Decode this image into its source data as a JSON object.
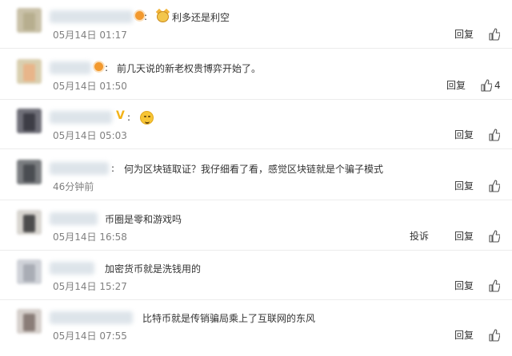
{
  "comments": [
    {
      "content": "利多还是利空",
      "time": "05月14日 01:17",
      "reply_label": "回复",
      "likes": "",
      "report_label": "",
      "avatar_color": "#c9c1a8",
      "avatar_core": "#b7ae8f"
    },
    {
      "content": "前几天说的新老权贵博弈开始了。",
      "time": "05月14日 01:50",
      "reply_label": "回复",
      "likes": "4",
      "report_label": "",
      "avatar_color": "#d9cfb0",
      "avatar_core": "#e8b58a"
    },
    {
      "content": "",
      "time": "05月14日 05:03",
      "reply_label": "回复",
      "likes": "",
      "report_label": "",
      "avatar_color": "#6f6f78",
      "avatar_core": "#3d3d46"
    },
    {
      "content": "何为区块链取证？我仔细看了看，感觉区块链就是个骗子模式",
      "time": "46分钟前",
      "reply_label": "回复",
      "likes": "",
      "report_label": "",
      "avatar_color": "#7a7d80",
      "avatar_core": "#4a4d52"
    },
    {
      "content": "币圈是零和游戏吗",
      "time": "05月14日 16:58",
      "reply_label": "回复",
      "likes": "",
      "report_label": "投诉",
      "avatar_color": "#d8d5d0",
      "avatar_core": "#4c4c4c"
    },
    {
      "content": "加密货币就是洗钱用的",
      "time": "05月14日 15:27",
      "reply_label": "回复",
      "likes": "",
      "report_label": "",
      "avatar_color": "#cfd2d8",
      "avatar_core": "#a9adb5"
    },
    {
      "content": "比特币就是传销骗局乘上了互联网的东风",
      "time": "05月14日 07:55",
      "reply_label": "回复",
      "likes": "",
      "report_label": "",
      "avatar_color": "#d6d0cc",
      "avatar_core": "#8a7d78"
    }
  ],
  "icons": {
    "like": "thumbs-up-icon",
    "member": "vip-member-icon",
    "verified": "verified-v-icon",
    "emoji_doge": "doge-emoji-icon",
    "emoji_smile": "smile-emoji-icon"
  }
}
